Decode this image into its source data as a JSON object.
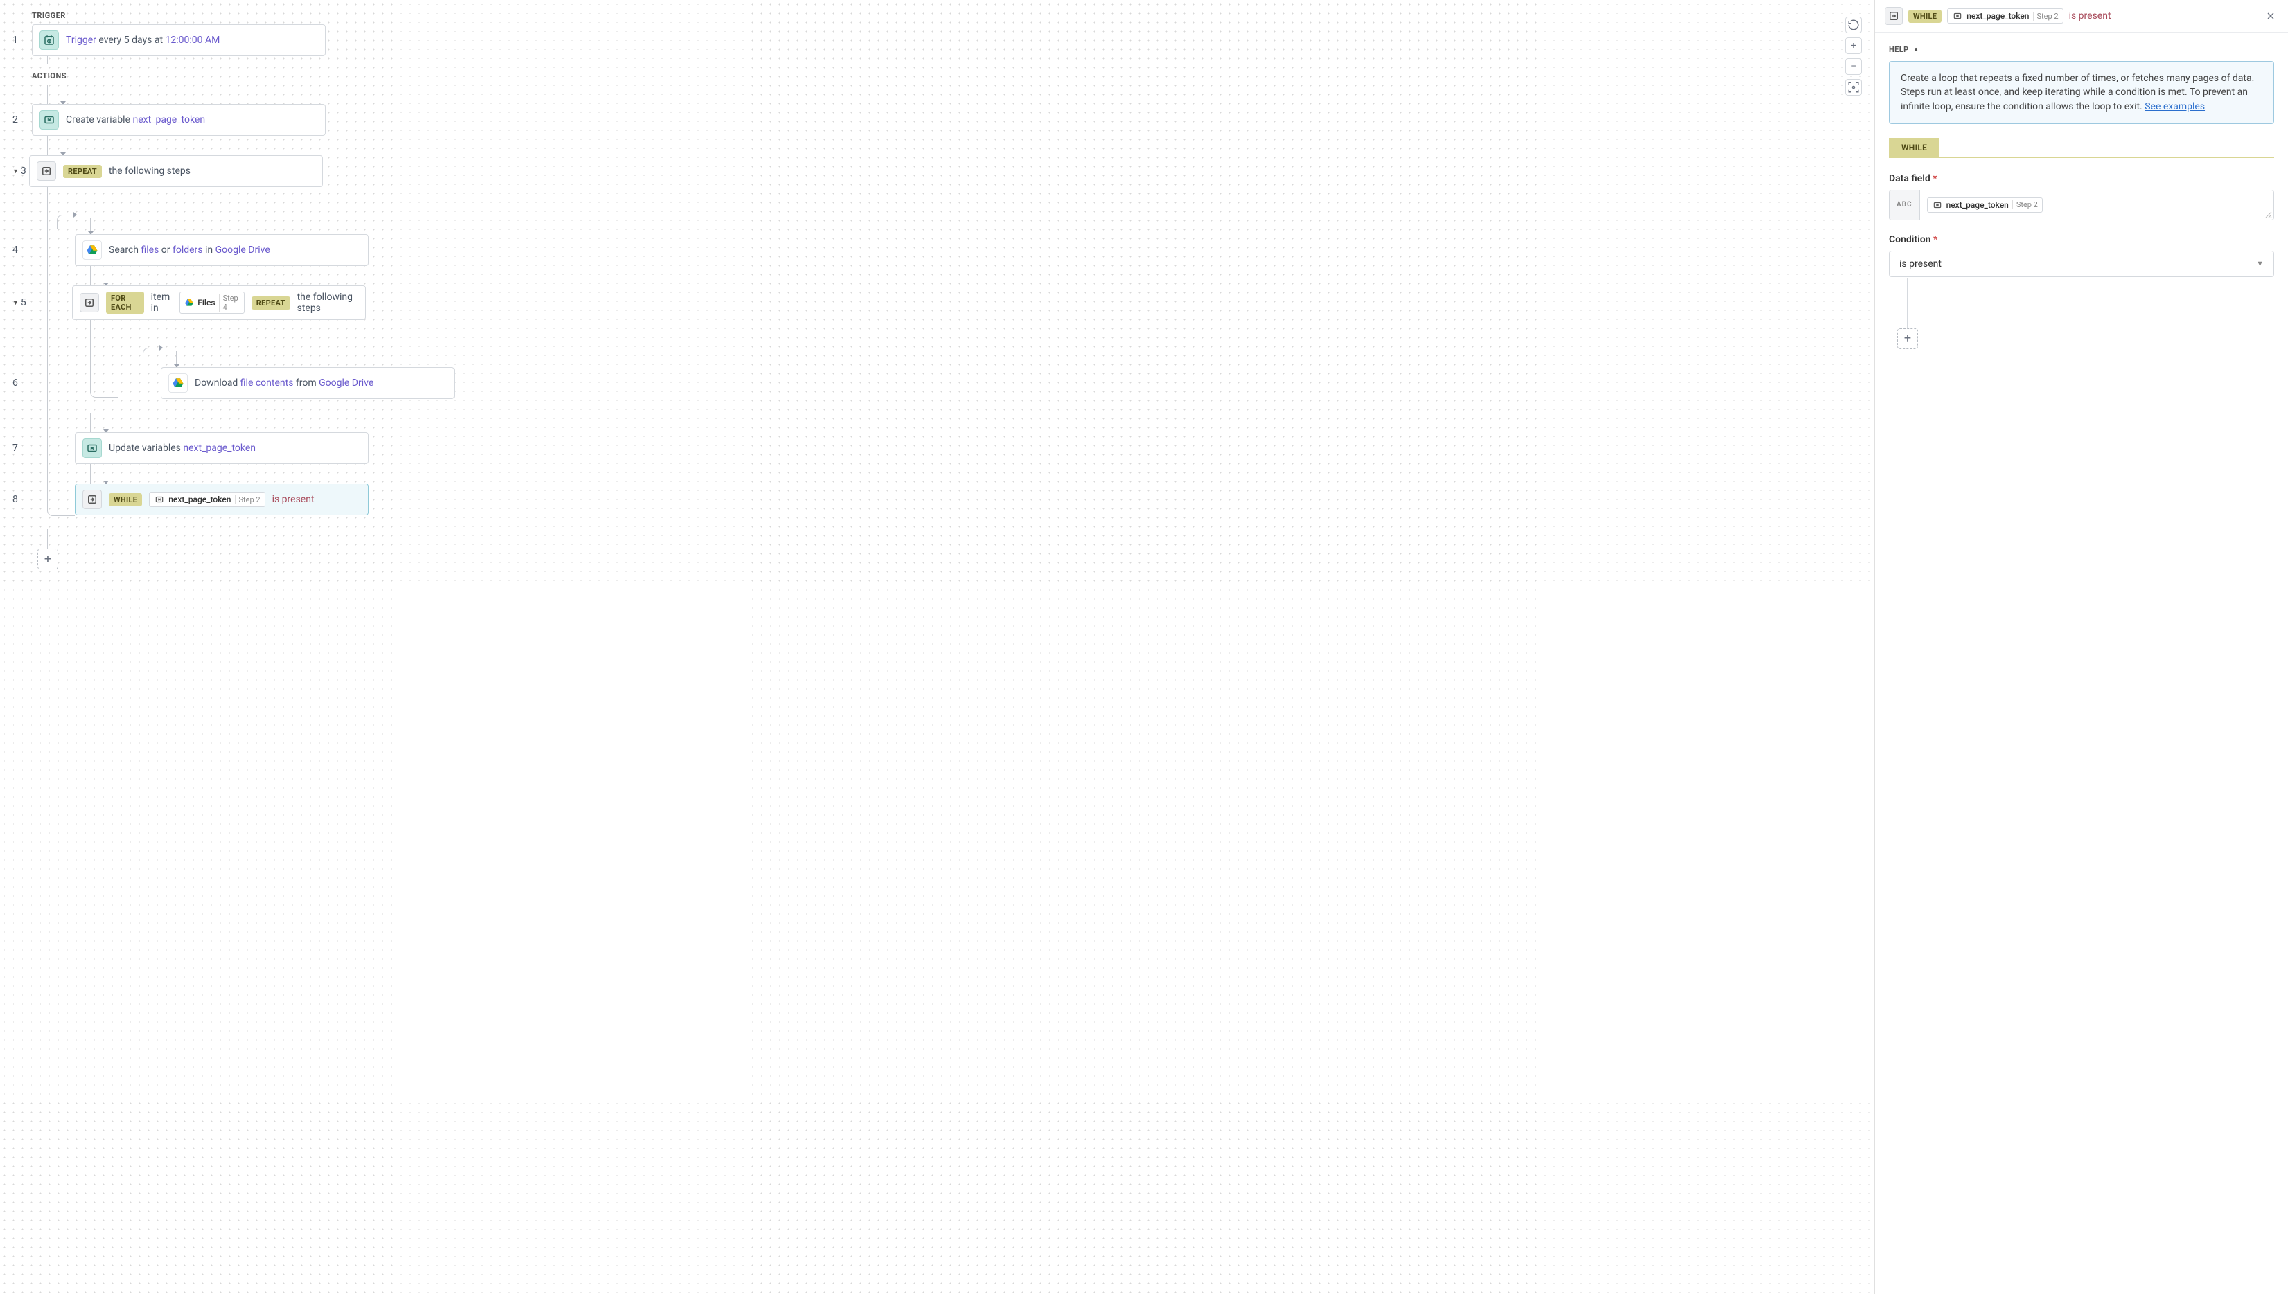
{
  "sections": {
    "trigger_label": "TRIGGER",
    "actions_label": "ACTIONS"
  },
  "steps": {
    "s1": {
      "num": "1",
      "prefix": "Trigger",
      "text_mid": " every 5 days at ",
      "time": "12:00:00 AM"
    },
    "s2": {
      "num": "2",
      "prefix": "Create variable ",
      "var": "next_page_token"
    },
    "s3": {
      "num": "3",
      "tag": "REPEAT",
      "text": "the following steps"
    },
    "s4": {
      "num": "4",
      "prefix": "Search ",
      "a": "files",
      "mid1": " or ",
      "b": "folders",
      "mid2": " in ",
      "c": "Google Drive"
    },
    "s5": {
      "num": "5",
      "tag1": "FOR EACH",
      "pre": "item in",
      "pill_main": "Files",
      "pill_sub": "Step 4",
      "tag2": "REPEAT",
      "post": "the following steps"
    },
    "s6": {
      "num": "6",
      "prefix": "Download ",
      "a": "file contents",
      "mid": " from ",
      "b": "Google Drive"
    },
    "s7": {
      "num": "7",
      "prefix": "Update variables ",
      "var": "next_page_token"
    },
    "s8": {
      "num": "8",
      "tag": "WHILE",
      "pill_main": "next_page_token",
      "pill_sub": "Step 2",
      "cond": "is present"
    }
  },
  "panel": {
    "header": {
      "tag": "WHILE",
      "pill_main": "next_page_token",
      "pill_sub": "Step 2",
      "cond": "is present"
    },
    "help_label": "HELP",
    "help_text": "Create a loop that repeats a fixed number of times, or fetches many pages of data. Steps run at least once, and keep iterating while a condition is met. To prevent an infinite loop, ensure the condition allows the loop to exit. ",
    "help_link": "See examples",
    "tab": "WHILE",
    "field1_label": "Data field",
    "field1_prefix": "ABC",
    "field1_pill_main": "next_page_token",
    "field1_pill_sub": "Step 2",
    "field2_label": "Condition",
    "field2_value": "is present"
  },
  "req": " *"
}
